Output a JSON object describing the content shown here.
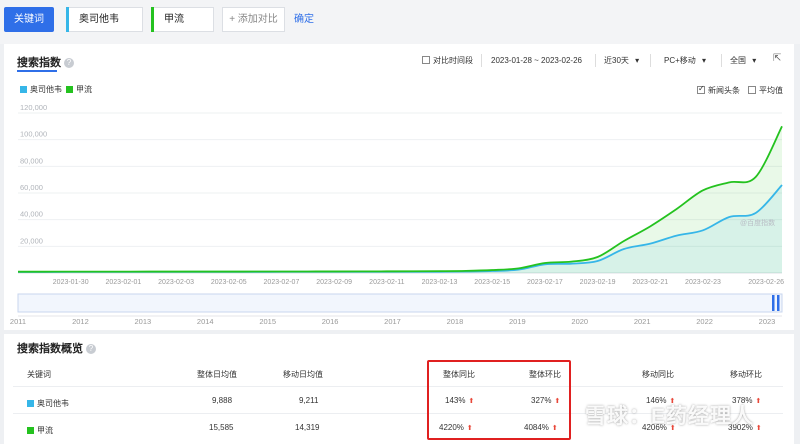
{
  "toolbar": {
    "keyword_tab": "关键词",
    "terms": [
      {
        "label": "奥司他韦",
        "color": "#36b6e8"
      },
      {
        "label": "甲流",
        "color": "#24c21f"
      }
    ],
    "add_compare": "+ 添加对比",
    "confirm": "确定"
  },
  "trend_panel": {
    "title": "搜索指数",
    "help": "?",
    "compare_period": "对比时间段",
    "date_range": "2023-01-28 ~ 2023-02-26",
    "period": "近30天",
    "device": "PC+移动",
    "region": "全国",
    "dropdown_arrow": "▾",
    "export_icon": "⇱",
    "opt_news": "新闻头条",
    "opt_avg": "平均值",
    "opt_news_checked": true,
    "opt_avg_checked": false,
    "source": "@百度指数"
  },
  "chart_data": {
    "type": "area",
    "x": [
      "2023-01-28",
      "2023-01-29",
      "2023-01-30",
      "2023-01-31",
      "2023-02-01",
      "2023-02-02",
      "2023-02-03",
      "2023-02-04",
      "2023-02-05",
      "2023-02-06",
      "2023-02-07",
      "2023-02-08",
      "2023-02-09",
      "2023-02-10",
      "2023-02-11",
      "2023-02-12",
      "2023-02-13",
      "2023-02-14",
      "2023-02-15",
      "2023-02-16",
      "2023-02-17",
      "2023-02-18",
      "2023-02-19",
      "2023-02-20",
      "2023-02-21",
      "2023-02-22",
      "2023-02-23",
      "2023-02-24",
      "2023-02-25",
      "2023-02-26"
    ],
    "x_ticks": [
      "2023-01-30",
      "2023-02-01",
      "2023-02-03",
      "2023-02-05",
      "2023-02-07",
      "2023-02-09",
      "2023-02-11",
      "2023-02-13",
      "2023-02-15",
      "2023-02-17",
      "2023-02-19",
      "2023-02-21",
      "2023-02-23",
      "2023-02-26"
    ],
    "y_ticks": [
      20000,
      40000,
      60000,
      80000,
      100000,
      120000
    ],
    "y_tick_labels": [
      "20,000",
      "40,000",
      "60,000",
      "80,000",
      "100,000",
      "120,000"
    ],
    "ylim": [
      0,
      120000
    ],
    "series": [
      {
        "name": "奥司他韦",
        "color": "#36b6e8",
        "values": [
          800,
          800,
          820,
          830,
          850,
          860,
          870,
          880,
          890,
          900,
          910,
          920,
          930,
          950,
          960,
          980,
          1000,
          1100,
          1500,
          2500,
          6500,
          7000,
          9000,
          18000,
          22000,
          28000,
          32000,
          42000,
          45000,
          66000
        ]
      },
      {
        "name": "甲流",
        "color": "#24c21f",
        "values": [
          1000,
          1000,
          1020,
          1030,
          1050,
          1060,
          1070,
          1080,
          1090,
          1100,
          1120,
          1150,
          1180,
          1200,
          1250,
          1300,
          1400,
          1600,
          2200,
          3500,
          7500,
          8500,
          12000,
          24000,
          35000,
          48000,
          62000,
          68000,
          72000,
          110000
        ]
      }
    ],
    "overview_years": [
      "2011",
      "2012",
      "2013",
      "2014",
      "2015",
      "2016",
      "2017",
      "2018",
      "2019",
      "2020",
      "2021",
      "2022",
      "2023"
    ]
  },
  "summary": {
    "title": "搜索指数概览",
    "help": "?",
    "headers": {
      "keyword": "关键词",
      "daily_avg": "整体日均值",
      "mobile_daily_avg": "移动日均值",
      "overall_yoy": "整体同比",
      "overall_mom": "整体环比",
      "mobile_yoy": "移动同比",
      "mobile_mom": "移动环比"
    },
    "up_arrow": "⬆",
    "rows": [
      {
        "keyword": "奥司他韦",
        "color": "#36b6e8",
        "daily_avg": "9,888",
        "mobile_daily_avg": "9,211",
        "overall_yoy": "143%",
        "overall_mom": "327%",
        "mobile_yoy": "146%",
        "mobile_mom": "378%"
      },
      {
        "keyword": "甲流",
        "color": "#24c21f",
        "daily_avg": "15,585",
        "mobile_daily_avg": "14,319",
        "overall_yoy": "4220%",
        "overall_mom": "4084%",
        "mobile_yoy": "4206%",
        "mobile_mom": "3902%"
      }
    ]
  },
  "watermark": "雪球：E药经理人"
}
